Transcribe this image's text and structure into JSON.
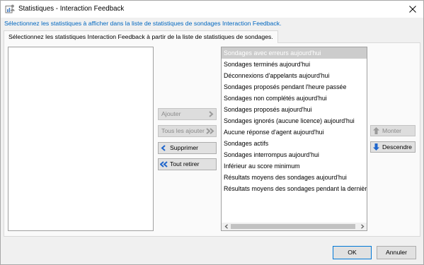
{
  "window": {
    "title": "Statistiques - Interaction Feedback",
    "icon": "chart-app-icon",
    "close_icon": "close-icon"
  },
  "instruction": "Sélectionnez les statistiques à afficher dans la liste de statistiques de sondages Interaction Feedback.",
  "tab": {
    "label": "Sélectionnez les statistiques Interaction Feedback à partir de la liste de statistiques de sondages."
  },
  "available_list": {
    "items": []
  },
  "selected_list": {
    "selected_index": 0,
    "items": [
      "Sondages avec erreurs aujourd'hui",
      "Sondages terminés aujourd'hui",
      "Déconnexions d'appelants aujourd'hui",
      "Sondages proposés pendant l'heure passée",
      "Sondages non complétés aujourd'hui",
      "Sondages proposés aujourd'hui",
      "Sondages ignorés (aucune licence) aujourd'hui",
      "Aucune réponse d'agent aujourd'hui",
      "Sondages actifs",
      "Sondages interrompus aujourd'hui",
      "Inférieur au score minimum",
      "Résultats moyens des sondages aujourd'hui",
      "Résultats moyens des sondages pendant la dernièr"
    ]
  },
  "transfer_buttons": {
    "add": {
      "label": "Ajouter",
      "enabled": false,
      "icon": "chevron-right-icon"
    },
    "add_all": {
      "label": "Tous les ajouter",
      "enabled": false,
      "icon": "double-chevron-right-icon"
    },
    "remove": {
      "label": "Supprimer",
      "enabled": true,
      "icon": "chevron-left-icon"
    },
    "remove_all": {
      "label": "Tout retirer",
      "enabled": true,
      "icon": "double-chevron-left-icon"
    }
  },
  "order_buttons": {
    "move_up": {
      "label": "Monter",
      "enabled": false,
      "icon": "arrow-up-icon"
    },
    "move_down": {
      "label": "Descendre",
      "enabled": true,
      "icon": "arrow-down-icon"
    }
  },
  "dialog_buttons": {
    "ok": {
      "label": "OK",
      "is_default": true
    },
    "cancel": {
      "label": "Annuler"
    }
  },
  "colors": {
    "instruction_text": "#0067c0",
    "action_icon": "#1f66cc",
    "selection_background": "#cccccc",
    "selection_text": "#ffffff",
    "default_button_border": "#0078d7"
  }
}
